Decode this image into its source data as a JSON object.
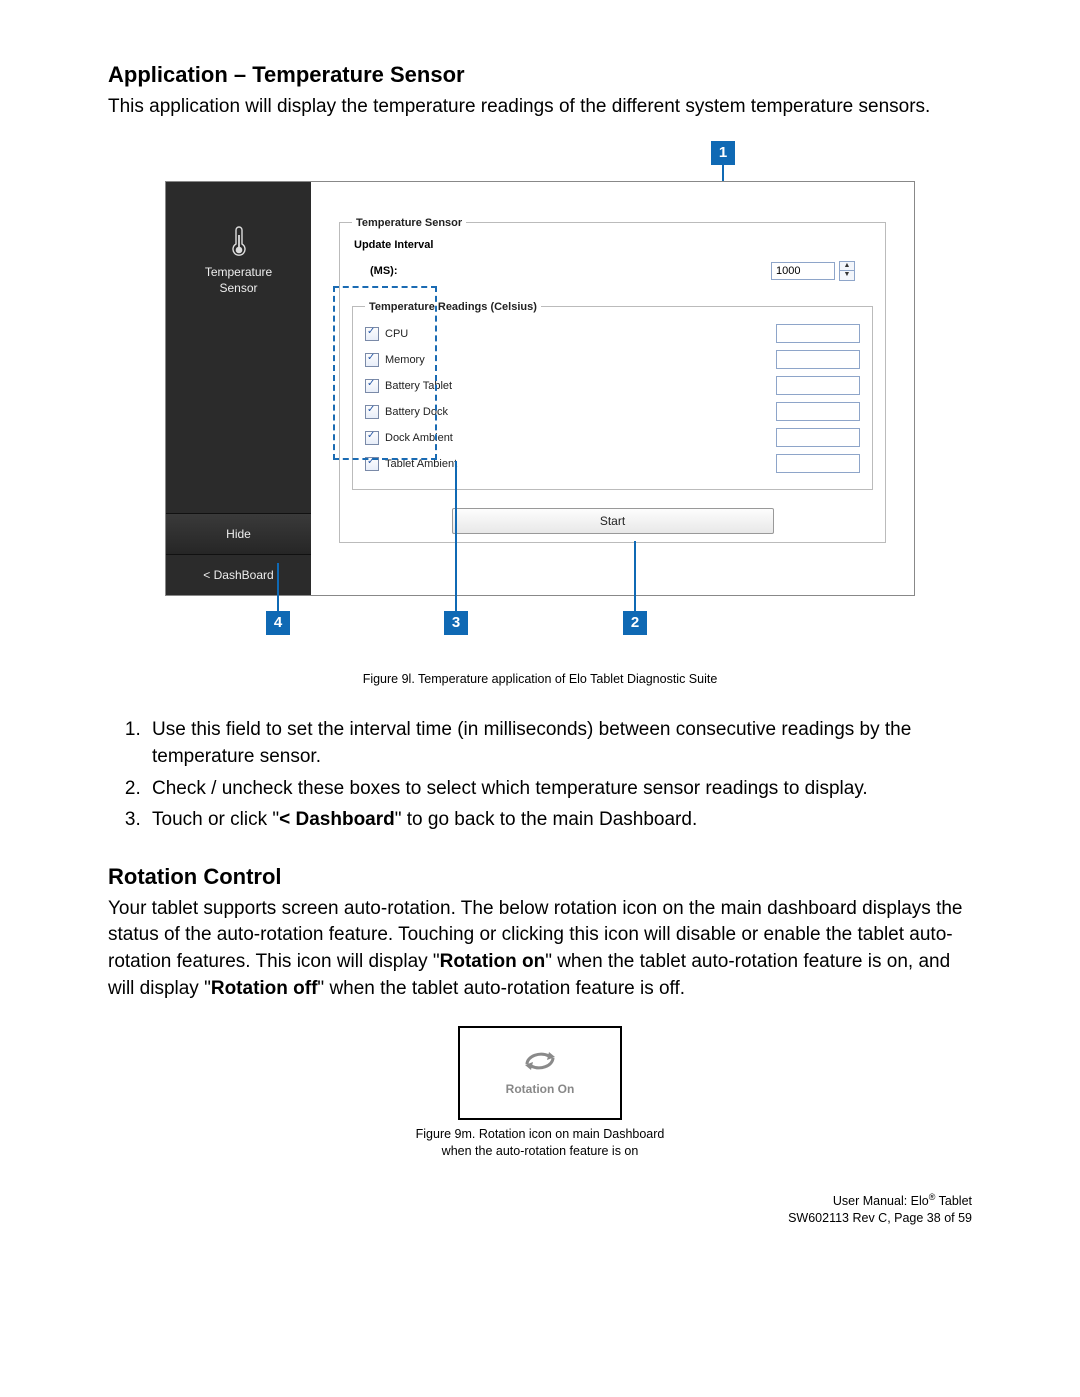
{
  "section1": {
    "heading": "Application – Temperature Sensor",
    "intro": "This application will display the temperature readings of the different system temperature sensors."
  },
  "screenshot": {
    "sidebar": {
      "label_line1": "Temperature",
      "label_line2": "Sensor",
      "hide": "Hide",
      "dashboard": "< DashBoard"
    },
    "ts_legend": "Temperature Sensor",
    "update_label": "Update Interval",
    "ms_label": "(MS):",
    "interval_value": "1000",
    "readings_legend": "Temperature Readings (Celsius)",
    "sensors": [
      "CPU",
      "Memory",
      "Battery Tablet",
      "Battery Dock",
      "Dock Ambient",
      "Tablet Ambient"
    ],
    "start": "Start"
  },
  "callouts": {
    "c1": "1",
    "c2": "2",
    "c3": "3",
    "c4": "4"
  },
  "fig1_caption": "Figure 9l. Temperature application of Elo Tablet Diagnostic Suite",
  "instructions": {
    "i1": "Use this field to set the interval time (in milliseconds) between consecutive readings by the temperature sensor.",
    "i2": "Check / uncheck these boxes to select which temperature sensor readings to display.",
    "i3_a": "Touch or click \"",
    "i3_b": "< Dashboard",
    "i3_c": "\" to go back to the main Dashboard."
  },
  "section2": {
    "heading": "Rotation Control",
    "p_a": "Your tablet supports screen auto-rotation. The below rotation icon on the main dashboard displays the status of the auto-rotation feature. Touching or clicking this icon will disable or enable the tablet auto-rotation features. This icon will display \"",
    "p_b": "Rotation on",
    "p_c": "\" when the tablet auto-rotation feature is on, and will display \"",
    "p_d": "Rotation off",
    "p_e": "\" when the tablet auto-rotation feature is off."
  },
  "rotation_box_label": "Rotation On",
  "fig2_caption_l1": "Figure 9m. Rotation icon on main Dashboard",
  "fig2_caption_l2": "when the auto-rotation feature is on",
  "footer": {
    "l1a": "User Manual: Elo",
    "l1b": " Tablet",
    "l2": "SW602113 Rev C, Page 38 of 59"
  }
}
